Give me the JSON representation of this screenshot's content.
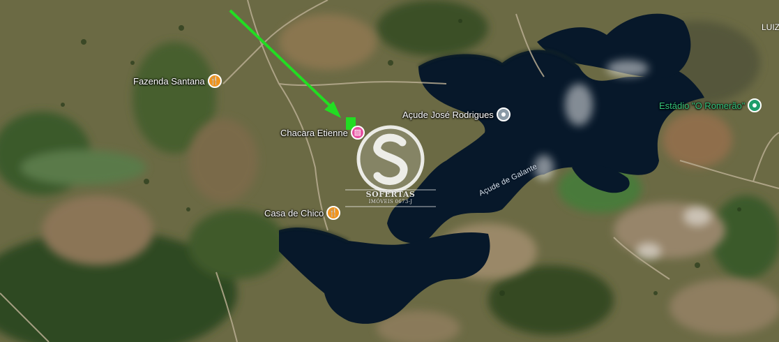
{
  "map": {
    "type": "satellite",
    "water_color": "#07182a",
    "arrow_color": "#22dd22"
  },
  "pois": [
    {
      "id": "fazenda-santana",
      "label": "Fazenda Santana",
      "icon": "restaurant-icon"
    },
    {
      "id": "acude-jose-rodrigues",
      "label": "Açude José Rodrigues",
      "icon": "place-icon"
    },
    {
      "id": "estadio-romerao",
      "label": "Estádio \"O Romerão\"",
      "icon": "park-icon"
    },
    {
      "id": "chacara-etienne",
      "label": "Chacara Etienne",
      "icon": "hotel-icon"
    },
    {
      "id": "casa-de-chico",
      "label": "Casa de Chico",
      "icon": "restaurant-icon"
    }
  ],
  "water_label": "Açude de Galante",
  "corner_label": "LUIZ",
  "watermark": {
    "brand": "SOFERTAS",
    "subtitle": "IMÓVEIS 0673-J"
  }
}
